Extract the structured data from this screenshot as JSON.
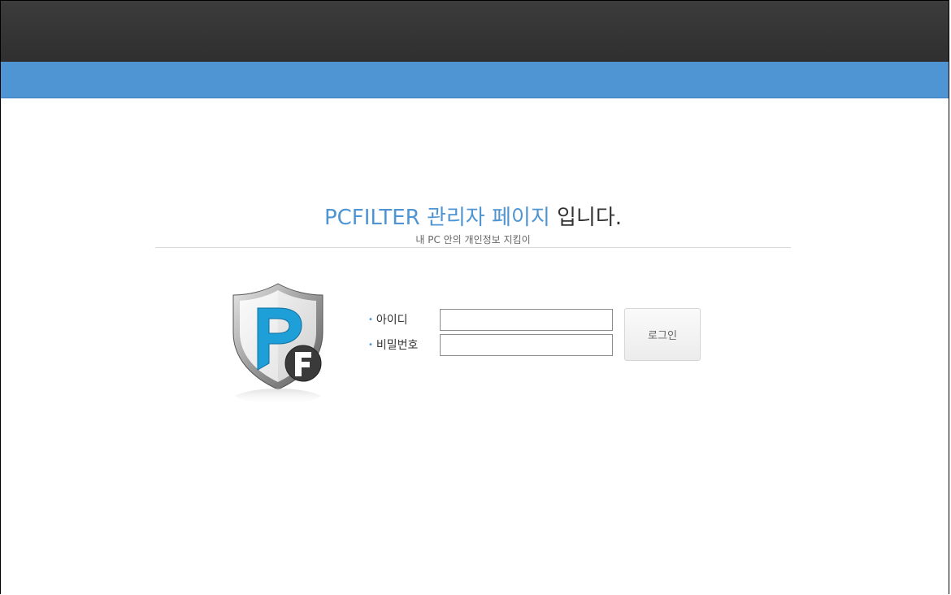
{
  "header": {
    "colors": {
      "top_bar": "#363636",
      "accent_bar": "#4f95d3"
    }
  },
  "heading": {
    "brand": "PCFILTER 관리자 페이지",
    "tail": " 입니다.",
    "subtitle": "내 PC 안의 개인정보 지킴이"
  },
  "logo": {
    "icon": "pcfilter-shield-logo",
    "letters": "PF"
  },
  "login_form": {
    "id_label": "아이디",
    "id_value": "",
    "password_label": "비밀번호",
    "password_value": "",
    "bullet": "•",
    "submit_label": "로그인"
  },
  "colors": {
    "accent": "#4f95d3",
    "text": "#333333"
  }
}
